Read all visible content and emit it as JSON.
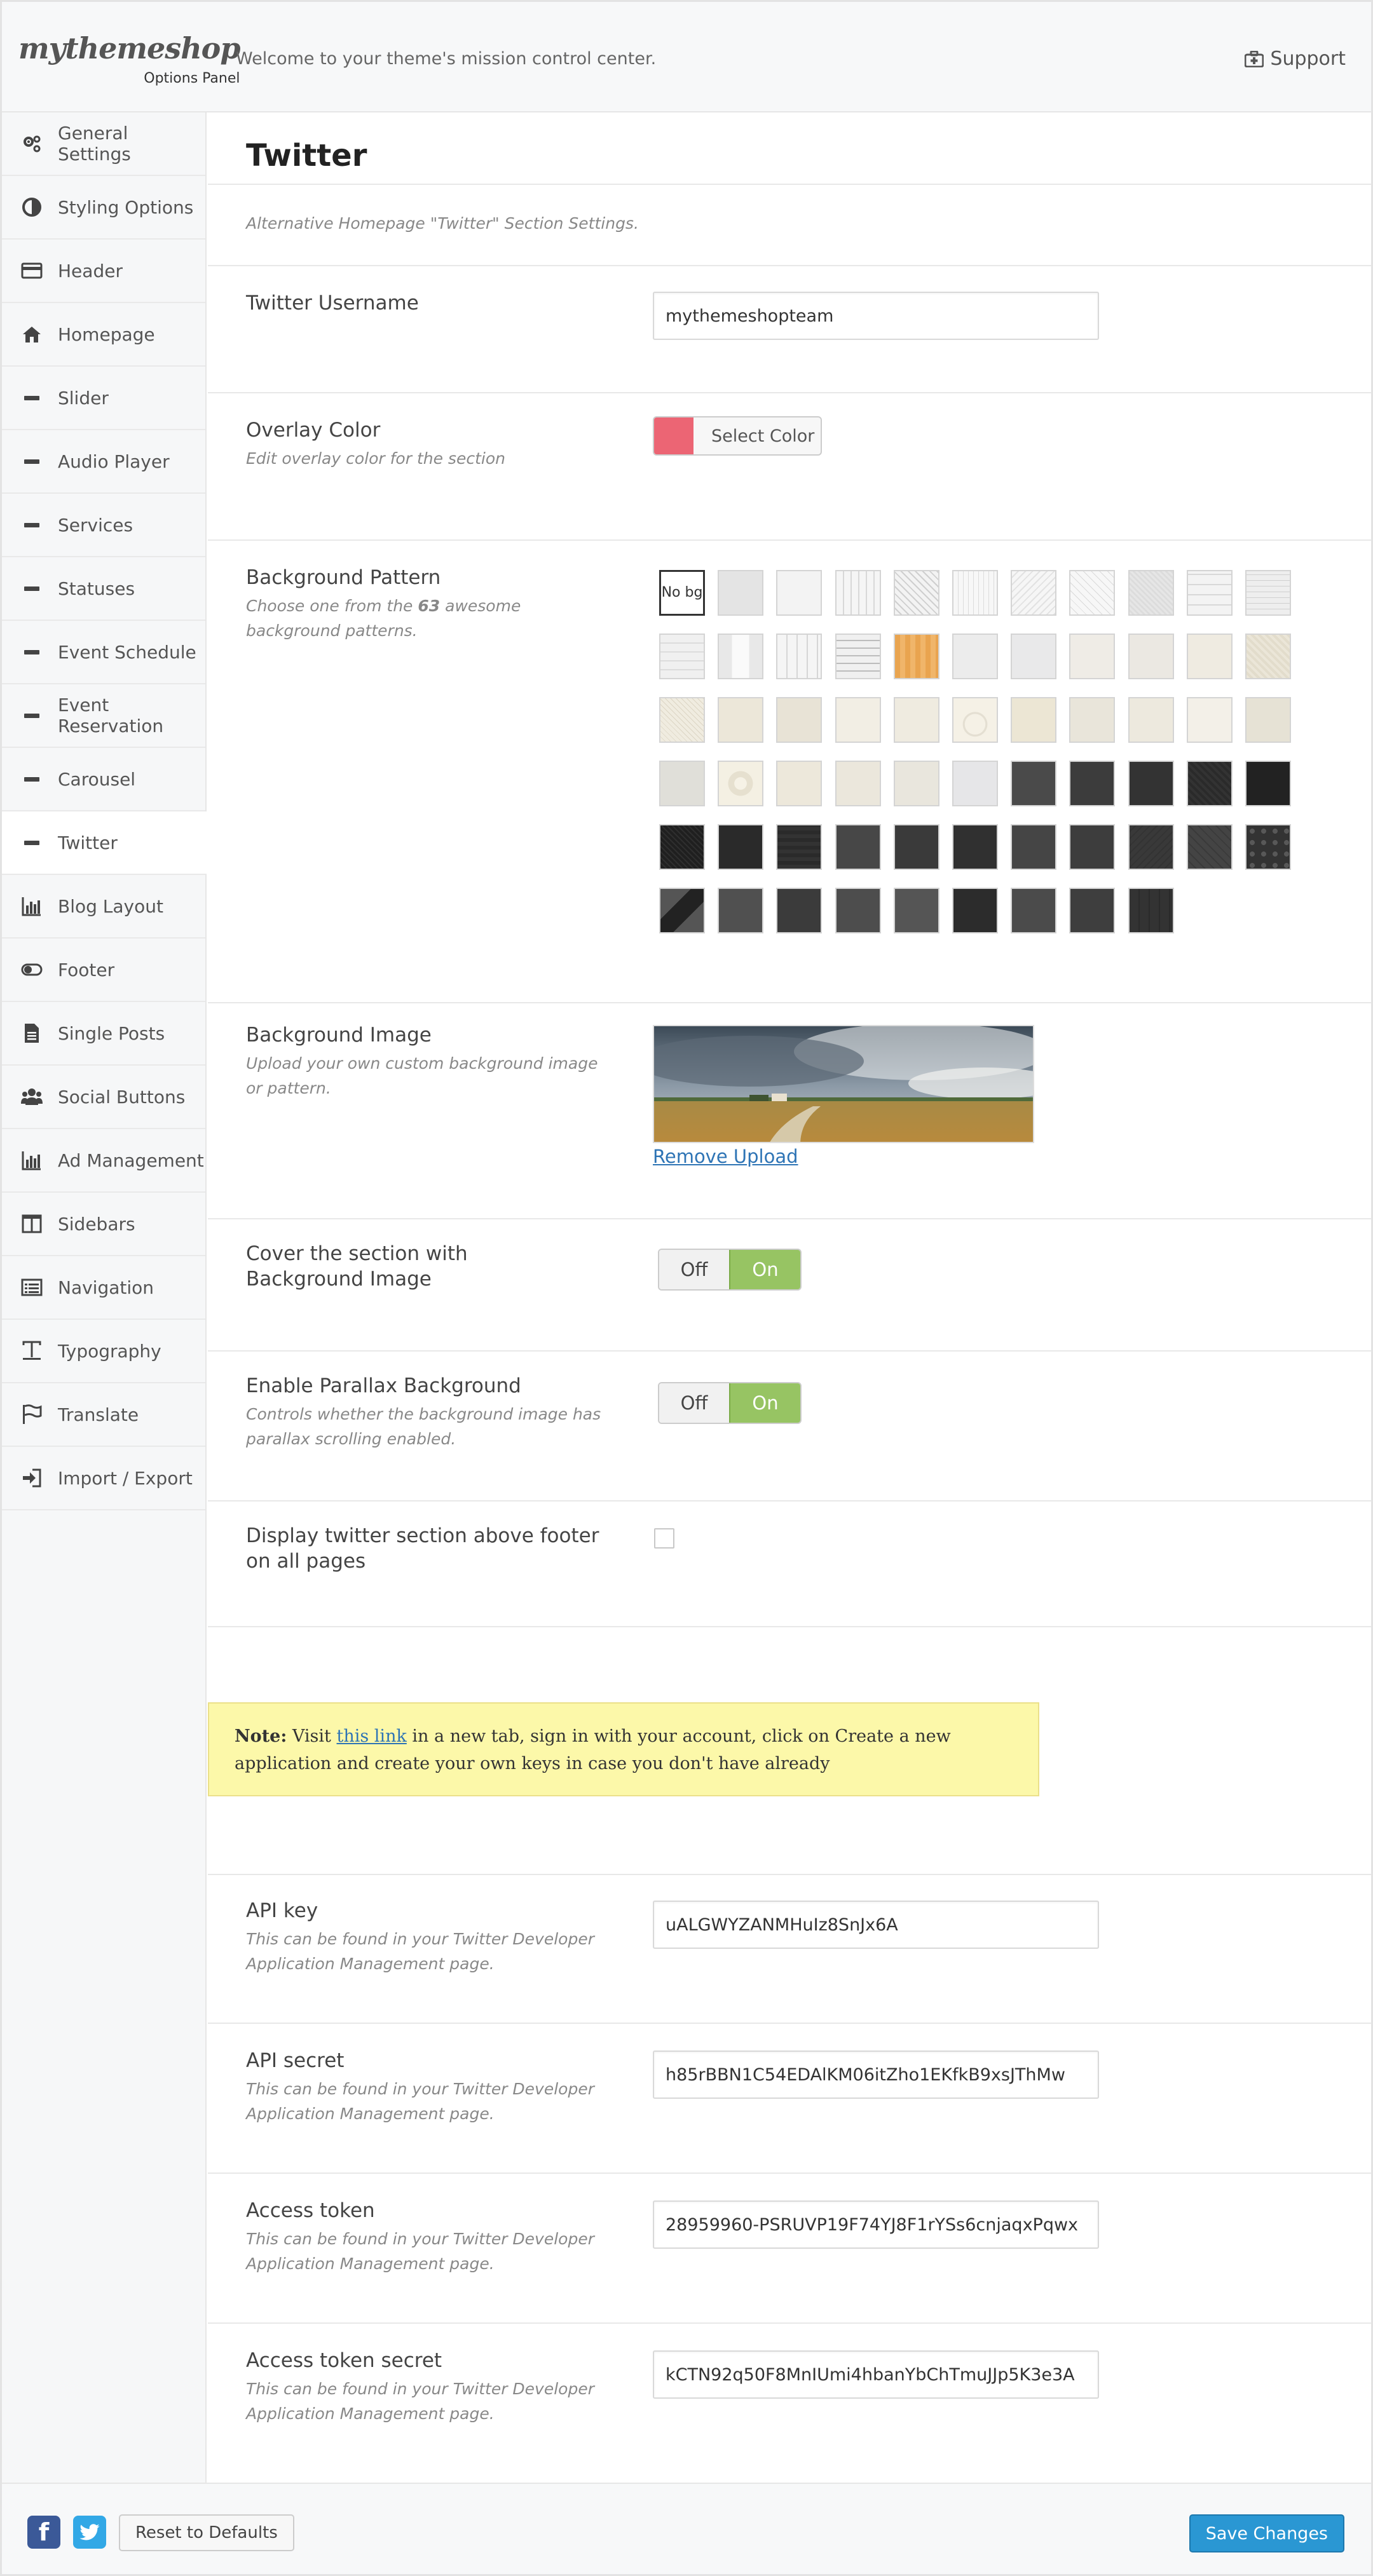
{
  "header": {
    "logo": "mythemeshop",
    "logo_sub": "Options Panel",
    "welcome": "Welcome to your theme's mission control center.",
    "support": "Support"
  },
  "sidebar": {
    "items": [
      {
        "label": "General Settings",
        "icon": "gears-icon"
      },
      {
        "label": "Styling Options",
        "icon": "contrast-icon"
      },
      {
        "label": "Header",
        "icon": "credit-card-icon"
      },
      {
        "label": "Homepage",
        "icon": "home-icon"
      },
      {
        "label": "Slider",
        "icon": "minus-icon"
      },
      {
        "label": "Audio Player",
        "icon": "minus-icon"
      },
      {
        "label": "Services",
        "icon": "minus-icon"
      },
      {
        "label": "Statuses",
        "icon": "minus-icon"
      },
      {
        "label": "Event Schedule",
        "icon": "minus-icon"
      },
      {
        "label": "Event Reservation",
        "icon": "minus-icon"
      },
      {
        "label": "Carousel",
        "icon": "minus-icon"
      },
      {
        "label": "Twitter",
        "icon": "minus-icon"
      },
      {
        "label": "Blog Layout",
        "icon": "bar-chart-icon"
      },
      {
        "label": "Footer",
        "icon": "toggle-icon"
      },
      {
        "label": "Single Posts",
        "icon": "document-icon"
      },
      {
        "label": "Social Buttons",
        "icon": "users-icon"
      },
      {
        "label": "Ad Management",
        "icon": "bar-chart-icon"
      },
      {
        "label": "Sidebars",
        "icon": "columns-icon"
      },
      {
        "label": "Navigation",
        "icon": "list-icon"
      },
      {
        "label": "Typography",
        "icon": "text-icon"
      },
      {
        "label": "Translate",
        "icon": "flag-icon"
      },
      {
        "label": "Import / Export",
        "icon": "sign-in-icon"
      }
    ],
    "active": "Twitter"
  },
  "main": {
    "title": "Twitter",
    "subdesc": "Alternative Homepage \"Twitter\" Section Settings.",
    "username": {
      "label": "Twitter Username",
      "value": "mythemeshopteam"
    },
    "overlay": {
      "label": "Overlay Color",
      "desc": "Edit overlay color for the section",
      "button": "Select Color",
      "color": "#ec6574"
    },
    "pattern": {
      "label": "Background Pattern",
      "desc_before": "Choose one from the ",
      "desc_count": "63",
      "desc_after": " awesome background patterns.",
      "nobg": "No bg"
    },
    "bgimage": {
      "label": "Background Image",
      "desc": "Upload your own custom background image or pattern.",
      "remove": "Remove Upload"
    },
    "cover": {
      "label": "Cover the section with Background Image",
      "off": "Off",
      "on": "On"
    },
    "parallax": {
      "label": "Enable Parallax Background",
      "desc": "Controls whether the background image has parallax scrolling enabled.",
      "off": "Off",
      "on": "On"
    },
    "display": {
      "label": "Display twitter section above footer on all pages"
    },
    "note": {
      "strong": "Note:",
      "pre": " Visit ",
      "link": "this link",
      "post": " in a new tab, sign in with your account, click on Create a new application and create your own keys in case you don't have already"
    },
    "api_desc": "This can be found in your Twitter Developer Application Management page.",
    "api_key": {
      "label": "API key",
      "value": "uALGWYZANMHuIz8SnJx6A"
    },
    "api_secret": {
      "label": "API secret",
      "value": "h85rBBN1C54EDAlKM06itZho1EKfkB9xsJThMw"
    },
    "access_token": {
      "label": "Access token",
      "value": "28959960-PSRUVP19F74YJ8F1rYSs6cnjaqxPqwx"
    },
    "access_secret": {
      "label": "Access token secret",
      "value": "kCTN92q50F8MnIUmi4hbanYbChTmuJJp5K3e3A"
    }
  },
  "footer": {
    "facebook": "f",
    "reset": "Reset to Defaults",
    "save": "Save Changes"
  },
  "colors": {
    "toggle_on": "#97c463",
    "save": "#2a97d3",
    "note_bg": "#fcf8a9",
    "overlay": "#ec6574"
  }
}
